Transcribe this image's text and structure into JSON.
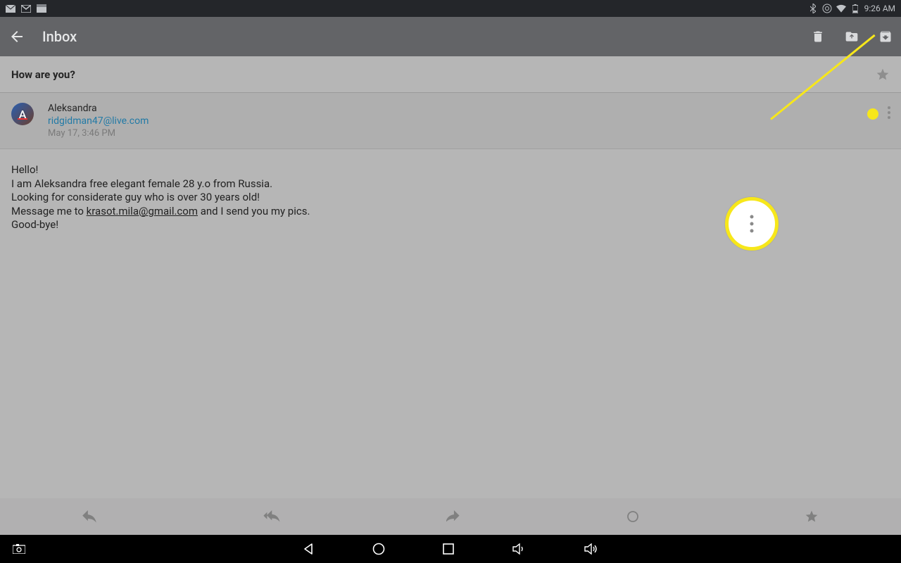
{
  "status_bar": {
    "time": "9:26 AM"
  },
  "app_bar": {
    "title": "Inbox"
  },
  "email": {
    "subject": "How are you?",
    "sender_name": "Aleksandra",
    "sender_email": "ridgidman47@live.com",
    "date": "May 17, 3:46 PM",
    "avatar_letter": "A",
    "body_line1": "Hello!",
    "body_line2": "I am Aleksandra free elegant female 28 y.o from Russia.",
    "body_line3": "Looking for considerate guy who is over 30 years old!",
    "body_line4a": "Message me to ",
    "body_link": "krasot.mila@gmail.com",
    "body_line4b": " and I send you my pics.",
    "body_line5": "Good-bye!"
  }
}
